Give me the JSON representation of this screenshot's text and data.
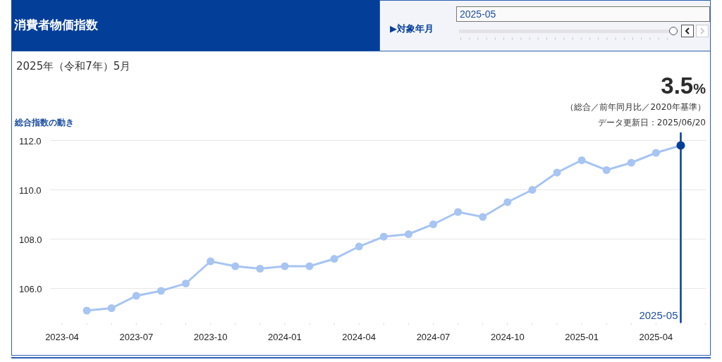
{
  "header": {
    "title": "消費者物価指数"
  },
  "period_selector": {
    "label": "▶対象年月",
    "value": "2025-05",
    "level": 1,
    "prev_disabled": false,
    "next_disabled": true
  },
  "period_label": "2025年（令和7年）5月",
  "headline": {
    "value": "3.5",
    "unit": "%",
    "note": "（総合／前年同月比／2020年基準）"
  },
  "chart_title": "総合指数の動き",
  "updated": "データ更新日：2025/06/20",
  "chart_data": {
    "type": "line",
    "categories": [
      "2023-04",
      null,
      null,
      "2023-07",
      null,
      null,
      "2023-10",
      null,
      null,
      "2024-01",
      null,
      null,
      "2024-04",
      null,
      null,
      "2024-07",
      null,
      null,
      "2024-10",
      null,
      null,
      "2025-01",
      null,
      null,
      "2025-04",
      null
    ],
    "series": [
      {
        "color": "#a7c4f2",
        "marker": "circle",
        "values": [
          null,
          105.1,
          105.2,
          105.7,
          105.9,
          106.2,
          107.1,
          106.9,
          106.8,
          106.9,
          106.9,
          107.2,
          107.7,
          108.1,
          108.2,
          108.6,
          109.1,
          108.9,
          109.5,
          110.0,
          110.7,
          111.2,
          110.8,
          111.1,
          111.5,
          111.8
        ]
      }
    ],
    "grid": true,
    "ylim": [
      104.6,
      112.3
    ],
    "yticks": [
      {
        "value": 106,
        "label": "106.0"
      },
      {
        "value": 108,
        "label": "108.0"
      },
      {
        "value": 110,
        "label": "110.0"
      },
      {
        "value": 112,
        "label": "112.0"
      }
    ],
    "annotations": [
      "2025-05"
    ]
  }
}
